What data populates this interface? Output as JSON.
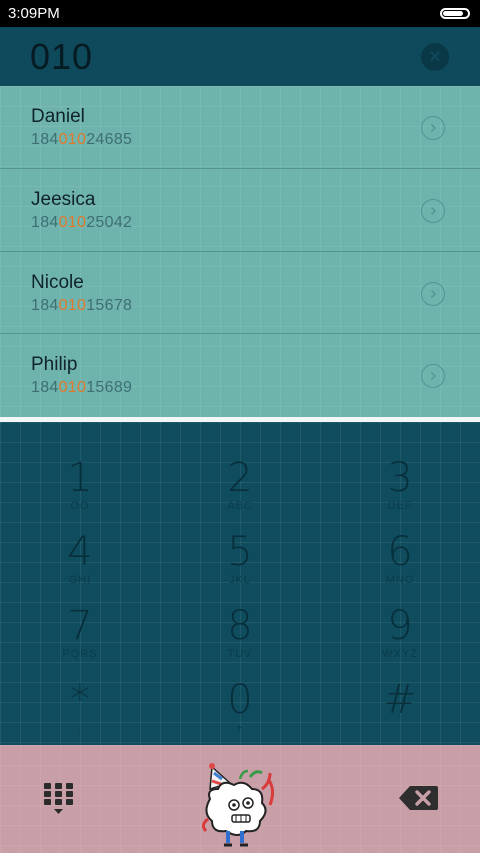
{
  "status_bar": {
    "time": "3:09PM",
    "battery_level": 0.85
  },
  "dialer": {
    "typed_number": "010"
  },
  "contacts": [
    {
      "name": "Daniel",
      "number_prefix": "184",
      "number_match": "010",
      "number_suffix": "24685"
    },
    {
      "name": "Jeesica",
      "number_prefix": "184",
      "number_match": "010",
      "number_suffix": "25042"
    },
    {
      "name": "Nicole",
      "number_prefix": "184",
      "number_match": "010",
      "number_suffix": "15678"
    },
    {
      "name": "Philip",
      "number_prefix": "184",
      "number_match": "010",
      "number_suffix": "15689"
    }
  ],
  "keypad": [
    {
      "digit": "1",
      "letters": "OO"
    },
    {
      "digit": "2",
      "letters": "ABC"
    },
    {
      "digit": "3",
      "letters": "DEF"
    },
    {
      "digit": "4",
      "letters": "GHI"
    },
    {
      "digit": "5",
      "letters": "JKL"
    },
    {
      "digit": "6",
      "letters": "MNO"
    },
    {
      "digit": "7",
      "letters": "PQRS"
    },
    {
      "digit": "8",
      "letters": "TUV"
    },
    {
      "digit": "9",
      "letters": "WXYZ"
    },
    {
      "digit": "*",
      "letters": ","
    },
    {
      "digit": "0",
      "letters": "+"
    },
    {
      "digit": "#",
      "letters": ""
    }
  ],
  "icons": {
    "clear": "close-icon",
    "detail": "chevron-right-icon",
    "dialpad": "dialpad-icon",
    "call": "mascot-call-icon",
    "backspace": "backspace-icon"
  },
  "colors": {
    "header": "#0e4a5c",
    "list": "#6fb3ad",
    "highlight": "#e07a2a",
    "keypad": "#0f4d5e",
    "bottom": "#c89ea7"
  }
}
